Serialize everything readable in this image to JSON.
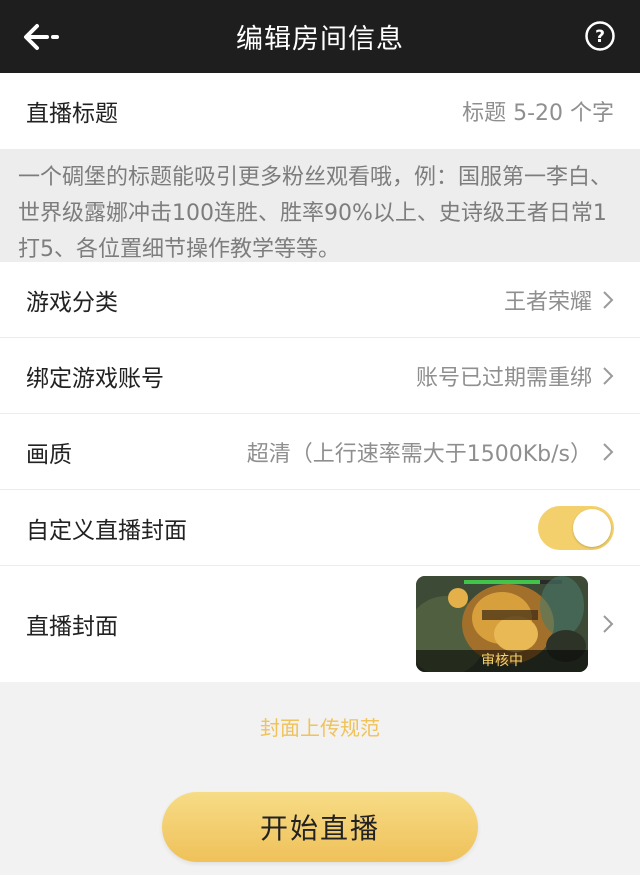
{
  "header": {
    "title": "编辑房间信息"
  },
  "form": {
    "live_title": {
      "label": "直播标题",
      "placeholder": "标题 5-20 个字"
    },
    "hint": "一个碉堡的标题能吸引更多粉丝观看哦，例：国服第一李白、世界级露娜冲击100连胜、胜率90%以上、史诗级王者日常1打5、各位置细节操作教学等等。",
    "game_category": {
      "label": "游戏分类",
      "value": "王者荣耀"
    },
    "bind_account": {
      "label": "绑定游戏账号",
      "value": "账号已过期需重绑"
    },
    "quality": {
      "label": "画质",
      "value": "超清（上行速率需大于1500Kb/s）"
    },
    "custom_cover": {
      "label": "自定义直播封面",
      "enabled": true
    },
    "cover": {
      "label": "直播封面",
      "status": "审核中"
    }
  },
  "links": {
    "upload_spec": "封面上传规范"
  },
  "actions": {
    "start_live": "开始直播"
  },
  "colors": {
    "accent": "#f3d06b",
    "header_bg": "#1e1e1e"
  }
}
